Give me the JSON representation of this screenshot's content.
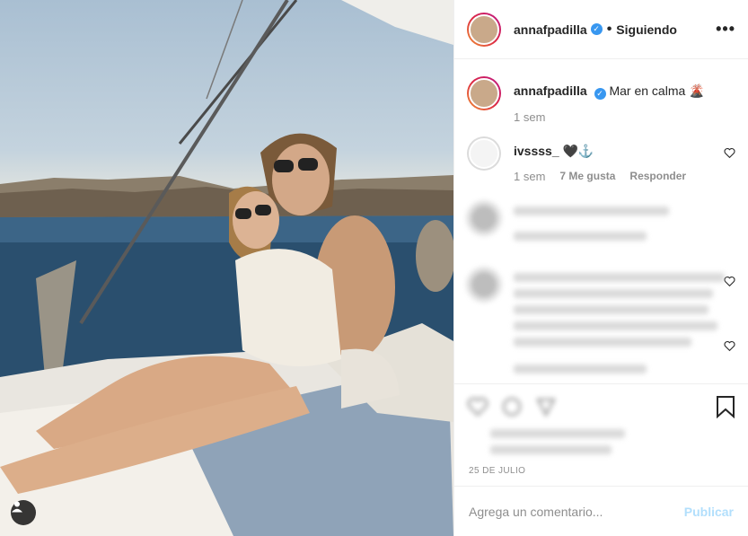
{
  "post": {
    "author": "annafpadilla",
    "follow_state": "Siguiendo",
    "more_label": "•••",
    "verified_glyph": "✓",
    "separator": "•"
  },
  "caption": {
    "username": "annafpadilla",
    "text": "Mar en calma",
    "emoji": "🌋",
    "age": "1 sem"
  },
  "comments": [
    {
      "username": "ivssss_",
      "text": "🖤⚓️",
      "age": "1 sem",
      "likes": "7 Me gusta",
      "reply": "Responder"
    }
  ],
  "date": "25 DE JULIO",
  "comment_box": {
    "placeholder": "Agrega un comentario...",
    "publish": "Publicar"
  },
  "icons": [
    "user-tag-icon",
    "more-options-icon",
    "heart-icon",
    "comment-icon",
    "share-icon",
    "bookmark-icon",
    "verified-icon"
  ],
  "colors": {
    "accent": "#3897f0",
    "publish_disabled": "#b2dffc",
    "muted": "#8e8e8e"
  }
}
